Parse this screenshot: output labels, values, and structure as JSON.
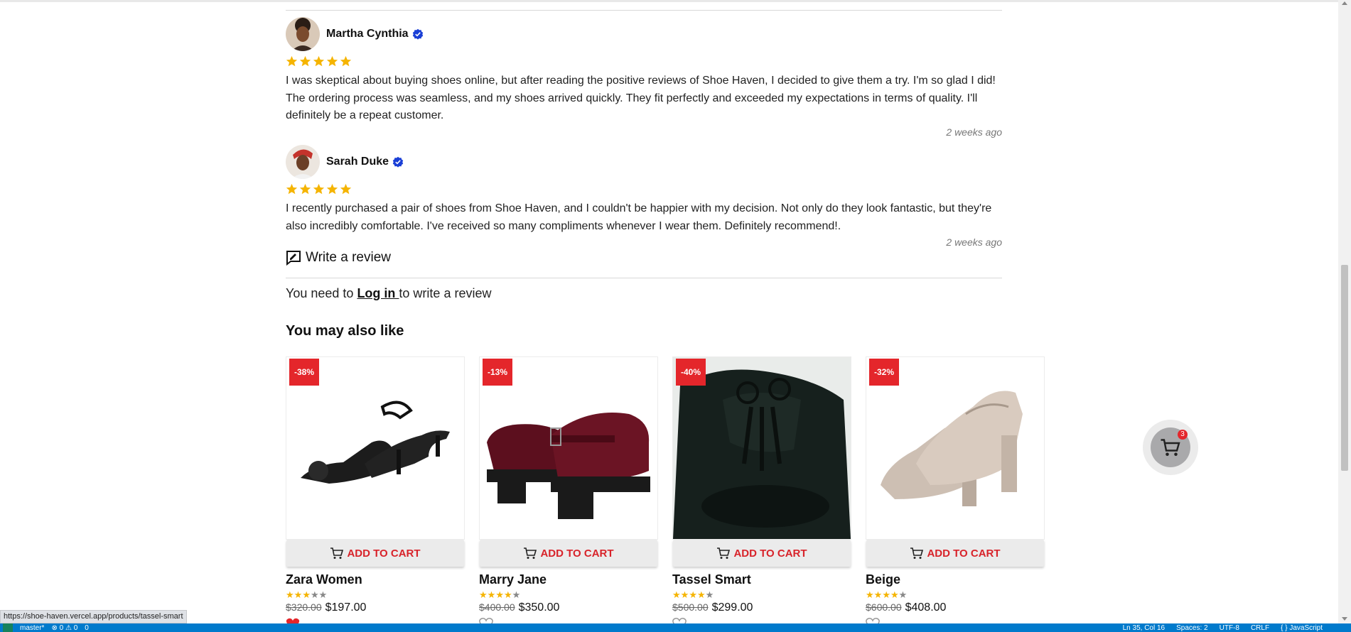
{
  "reviews": [
    {
      "name": "Martha Cynthia",
      "rating": 5,
      "text": "I was skeptical about buying shoes online, but after reading the positive reviews of Shoe Haven, I decided to give them a try. I'm so glad I did! The ordering process was seamless, and my shoes arrived quickly. They fit perfectly and exceeded my expectations in terms of quality. I'll definitely be a repeat customer.",
      "time": "2 weeks ago"
    },
    {
      "name": "Sarah Duke",
      "rating": 5,
      "text": "I recently purchased a pair of shoes from Shoe Haven, and I couldn't be happier with my decision. Not only do they look fantastic, but they're also incredibly comfortable. I've received so many compliments whenever I wear them. Definitely recommend!.",
      "time": "2 weeks ago"
    }
  ],
  "write_review": {
    "title": "Write a review",
    "login_prefix": "You need to ",
    "login_link": "Log in ",
    "login_suffix": "to write a review"
  },
  "also_like": {
    "title": "You may also like",
    "add_to_cart_label": "ADD TO CART",
    "products": [
      {
        "name": "Zara Women",
        "discount": "-38%",
        "rating": 3,
        "old_price": "$320.00",
        "new_price": "$197.00",
        "favorited": true
      },
      {
        "name": "Marry Jane",
        "discount": "-13%",
        "rating": 4,
        "old_price": "$400.00",
        "new_price": "$350.00",
        "favorited": false
      },
      {
        "name": "Tassel Smart",
        "discount": "-40%",
        "rating": 4,
        "old_price": "$500.00",
        "new_price": "$299.00",
        "favorited": false
      },
      {
        "name": "Beige",
        "discount": "-32%",
        "rating": 4,
        "old_price": "$600.00",
        "new_price": "$408.00",
        "favorited": false
      }
    ]
  },
  "floating_cart": {
    "count": "3"
  },
  "url_tooltip": "https://shoe-haven.vercel.app/products/tassel-smart",
  "statusbar": {
    "branch": "master*",
    "problems": "⊗ 0 ⚠ 0",
    "ports": "0",
    "cursor": "Ln 35, Col 16",
    "spaces": "Spaces: 2",
    "encoding": "UTF-8",
    "eol": "CRLF",
    "language": "{ } JavaScript"
  },
  "colors": {
    "accent_red": "#e4262b",
    "star_gold": "#f5b400",
    "verified_blue": "#1a3fd6",
    "status_blue": "#007acc"
  }
}
